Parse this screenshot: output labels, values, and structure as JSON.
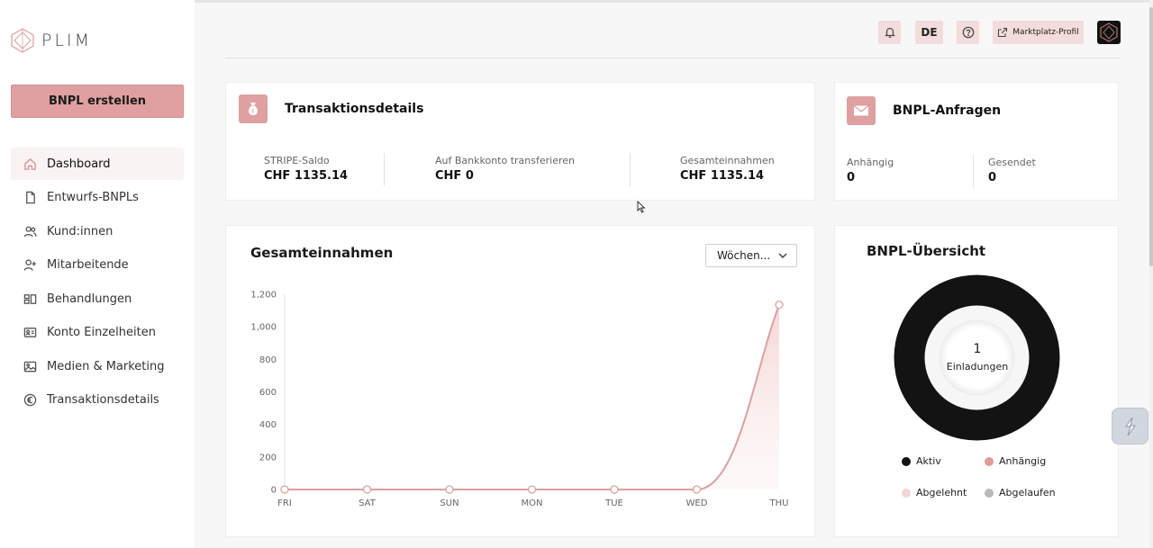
{
  "brand": {
    "name": "PLIM"
  },
  "sidebar": {
    "create_button": "BNPL erstellen",
    "items": [
      {
        "label": "Dashboard",
        "icon": "home-icon",
        "active": true
      },
      {
        "label": "Entwurfs-BNPLs",
        "icon": "document-icon"
      },
      {
        "label": "Kund:innen",
        "icon": "users-icon"
      },
      {
        "label": "Mitarbeitende",
        "icon": "user-plus-icon"
      },
      {
        "label": "Behandlungen",
        "icon": "treatments-icon"
      },
      {
        "label": "Konto Einzelheiten",
        "icon": "id-card-icon"
      },
      {
        "label": "Medien & Marketing",
        "icon": "image-icon"
      },
      {
        "label": "Transaktionsdetails",
        "icon": "euro-icon"
      }
    ]
  },
  "topbar": {
    "language": "DE",
    "marketplace_label": "Marktplatz-Profil"
  },
  "transactions_card": {
    "title": "Transaktionsdetails",
    "stats": [
      {
        "label": "STRIPE-Saldo",
        "value": "CHF 1135.14"
      },
      {
        "label": "Auf Bankkonto transferieren",
        "value": "CHF 0"
      },
      {
        "label": "Gesamteinnahmen",
        "value": "CHF 1135.14"
      }
    ]
  },
  "requests_card": {
    "title": "BNPL-Anfragen",
    "stats": [
      {
        "label": "Anhängig",
        "value": "0"
      },
      {
        "label": "Gesendet",
        "value": "0"
      }
    ]
  },
  "revenue_card": {
    "title": "Gesamteinnahmen",
    "dropdown_value": "Wöchen..."
  },
  "chart_data": {
    "type": "area",
    "title": "Gesamteinnahmen",
    "categories": [
      "FRI",
      "SAT",
      "SUN",
      "MON",
      "TUE",
      "WED",
      "THU"
    ],
    "values": [
      0,
      0,
      0,
      0,
      0,
      0,
      1135.14
    ],
    "y_ticks": [
      "0",
      "200",
      "400",
      "600",
      "800",
      "1,000",
      "1,200"
    ],
    "ylim": [
      0,
      1200
    ],
    "grid": false,
    "color": "#dea0a0"
  },
  "overview_card": {
    "title": "BNPL-Übersicht",
    "center_value": "1",
    "center_label": "Einladungen",
    "legend": [
      {
        "label": "Aktiv",
        "color": "#111111"
      },
      {
        "label": "Anhängig",
        "color": "#e39a9a"
      },
      {
        "label": "Abgelehnt",
        "color": "#f0d6d6"
      },
      {
        "label": "Abgelaufen",
        "color": "#b9b9b9"
      }
    ],
    "segments": [
      {
        "label": "Aktiv",
        "value": 1,
        "color": "#111111"
      }
    ]
  }
}
